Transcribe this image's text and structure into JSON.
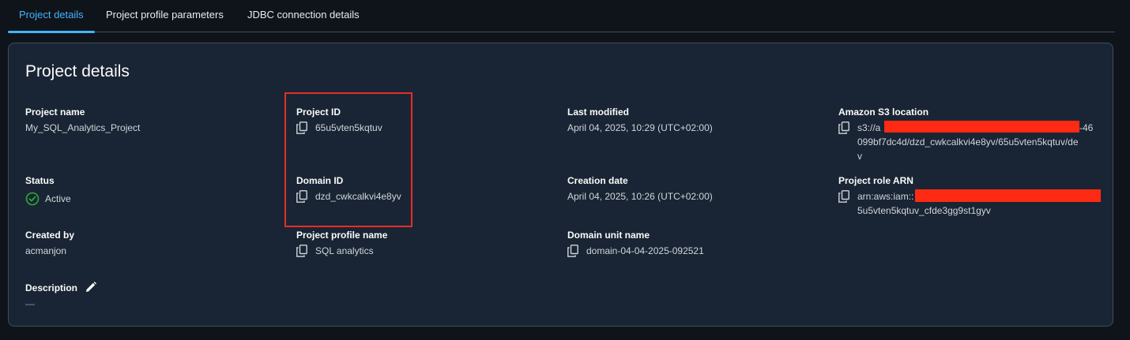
{
  "tabs": [
    {
      "label": "Project details",
      "active": true
    },
    {
      "label": "Project profile parameters",
      "active": false
    },
    {
      "label": "JDBC connection details",
      "active": false
    }
  ],
  "card": {
    "title": "Project details",
    "project_name": {
      "label": "Project name",
      "value": "My_SQL_Analytics_Project"
    },
    "project_id": {
      "label": "Project ID",
      "value": "65u5vten5kqtuv"
    },
    "last_modified": {
      "label": "Last modified",
      "value": "April 04, 2025, 10:29 (UTC+02:00)"
    },
    "s3_location": {
      "label": "Amazon S3 location",
      "value_line1": "s3://a",
      "value_line1_suffix": "-46",
      "value_line2": "099bf7dc4d/dzd_cwkcalkvi4e8yv/65u5vten5kqtuv/de",
      "value_line3": "v"
    },
    "status": {
      "label": "Status",
      "value": "Active"
    },
    "domain_id": {
      "label": "Domain ID",
      "value": "dzd_cwkcalkvi4e8yv"
    },
    "creation_date": {
      "label": "Creation date",
      "value": "April 04, 2025, 10:26 (UTC+02:00)"
    },
    "role_arn": {
      "label": "Project role ARN",
      "value_line1": "arn:aws:iam::",
      "value_line2": "5u5vten5kqtuv_cfde3gg9st1gyv"
    },
    "created_by": {
      "label": "Created by",
      "value": "acmanjon"
    },
    "profile_name": {
      "label": "Project profile name",
      "value": "SQL analytics"
    },
    "domain_unit": {
      "label": "Domain unit name",
      "value": "domain-04-04-2025-092521"
    },
    "description": {
      "label": "Description",
      "value": "—"
    }
  },
  "colors": {
    "accent": "#42b4ff",
    "success": "#29ad32",
    "highlight_border": "#e52e2a",
    "redaction": "#ff2a13"
  },
  "icons": [
    "copy-icon",
    "check-circle-icon",
    "edit-pencil-icon"
  ]
}
